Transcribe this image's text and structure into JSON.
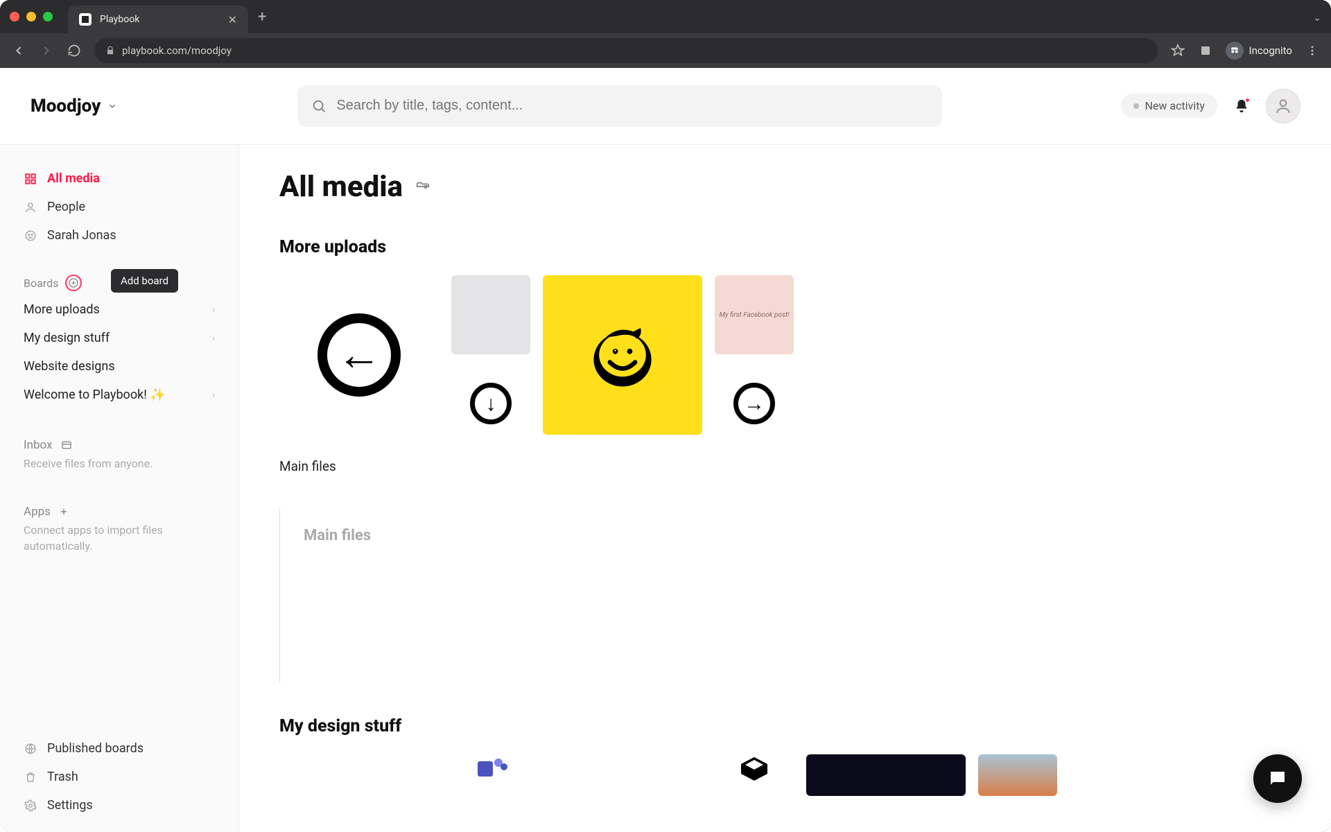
{
  "browser": {
    "tab_title": "Playbook",
    "url": "playbook.com/moodjoy",
    "incognito_label": "Incognito"
  },
  "header": {
    "workspace_name": "Moodjoy",
    "search_placeholder": "Search by title, tags, content...",
    "activity_label": "New activity"
  },
  "sidebar": {
    "nav": {
      "all_media": "All media",
      "people": "People",
      "user_name": "Sarah Jonas"
    },
    "boards_label": "Boards",
    "tooltip_add_board": "Add board",
    "boards": {
      "b0": "More uploads",
      "b1": "My design stuff",
      "b2": "Website designs",
      "b3": "Welcome to Playbook! ✨"
    },
    "inbox": {
      "title": "Inbox",
      "desc": "Receive files from anyone."
    },
    "apps": {
      "title": "Apps",
      "desc": "Connect apps to import files automatically."
    },
    "bottom": {
      "published": "Published boards",
      "trash": "Trash",
      "settings": "Settings"
    }
  },
  "main": {
    "page_title": "All media",
    "section1_title": "More uploads",
    "row_label_main_files": "Main files",
    "pink_card_text": "My first Facebook post!",
    "empty_folder_title": "Main files",
    "section2_title": "My design stuff"
  }
}
